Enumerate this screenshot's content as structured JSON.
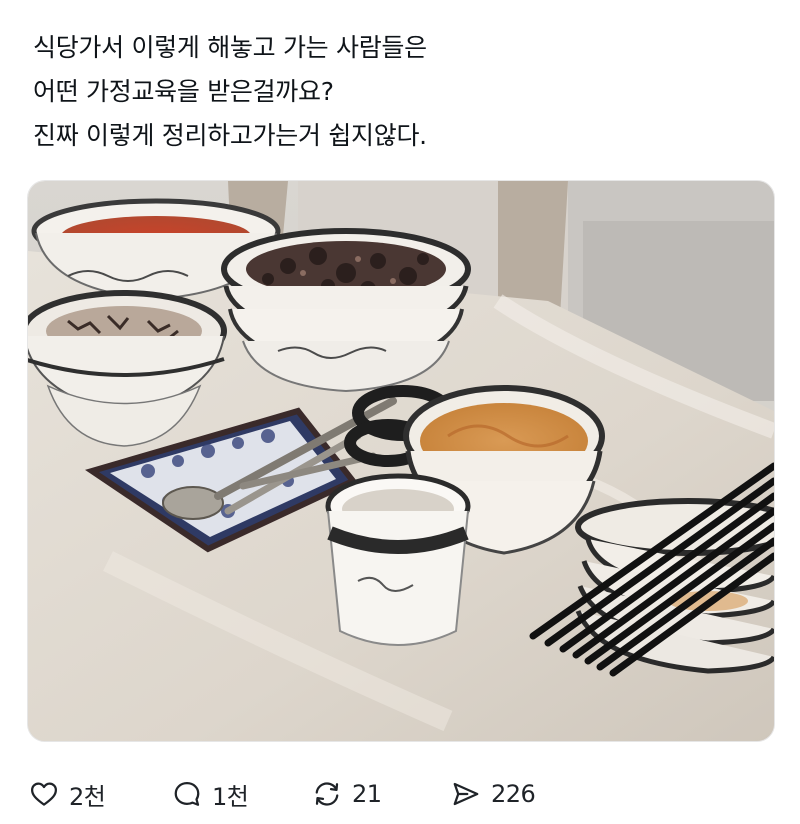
{
  "post": {
    "lines": [
      "식당가서 이렇게 해놓고 가는 사람들은",
      "어떤 가정교육을 받은걸까요?",
      "진짜 이렇게 정리하고가는거 쉽지않다."
    ]
  },
  "media": {
    "icon": "photo-of-stacked-dishes-on-restaurant-table"
  },
  "actions": {
    "like": {
      "icon": "heart-icon",
      "count": "2천"
    },
    "reply": {
      "icon": "speech-bubble-icon",
      "count": "1천"
    },
    "repost": {
      "icon": "repost-icon",
      "count": "21"
    },
    "share": {
      "icon": "send-icon",
      "count": "226"
    }
  }
}
